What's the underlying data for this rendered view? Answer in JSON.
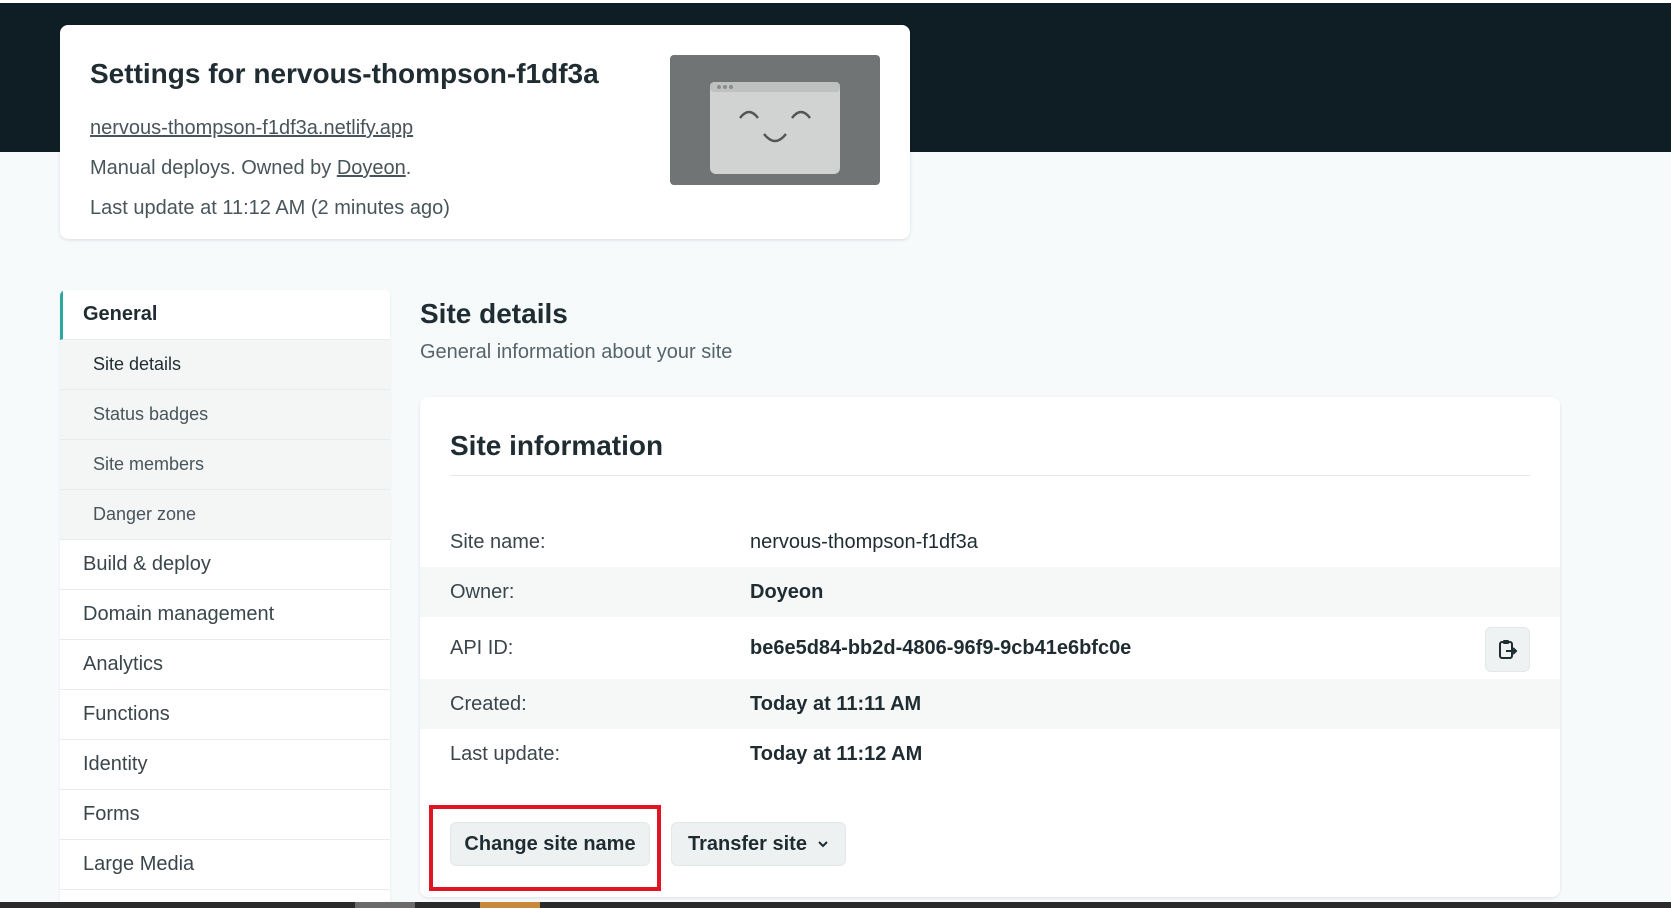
{
  "header": {
    "title": "Settings for nervous-thompson-f1df3a",
    "url": "nervous-thompson-f1df3a.netlify.app",
    "deploy_prefix": "Manual deploys. Owned by ",
    "owner_link": "Doyeon",
    "deploy_suffix": ".",
    "last_update": "Last update at 11:12 AM (2 minutes ago)"
  },
  "sidebar": {
    "items": [
      {
        "label": "General"
      },
      {
        "label": "Site details"
      },
      {
        "label": "Status badges"
      },
      {
        "label": "Site members"
      },
      {
        "label": "Danger zone"
      },
      {
        "label": "Build & deploy"
      },
      {
        "label": "Domain management"
      },
      {
        "label": "Analytics"
      },
      {
        "label": "Functions"
      },
      {
        "label": "Identity"
      },
      {
        "label": "Forms"
      },
      {
        "label": "Large Media"
      }
    ]
  },
  "main": {
    "section_title": "Site details",
    "section_subtitle": "General information about your site",
    "card_title": "Site information",
    "rows": [
      {
        "label": "Site name:",
        "value": "nervous-thompson-f1df3a"
      },
      {
        "label": "Owner:",
        "value": "Doyeon"
      },
      {
        "label": "API ID:",
        "value": "be6e5d84-bb2d-4806-96f9-9cb41e6bfc0e"
      },
      {
        "label": "Created:",
        "value": "Today at 11:11 AM"
      },
      {
        "label": "Last update:",
        "value": "Today at 11:12 AM"
      }
    ],
    "change_button": "Change site name",
    "transfer_button": "Transfer site"
  },
  "icons": {
    "copy": "clipboard-copy-icon",
    "preview": "site-preview-placeholder-icon",
    "dropdown": "chevron-down-icon"
  },
  "colors": {
    "top_band": "#0f1e25",
    "accent": "#2aa8a0",
    "highlight": "#e01424"
  }
}
